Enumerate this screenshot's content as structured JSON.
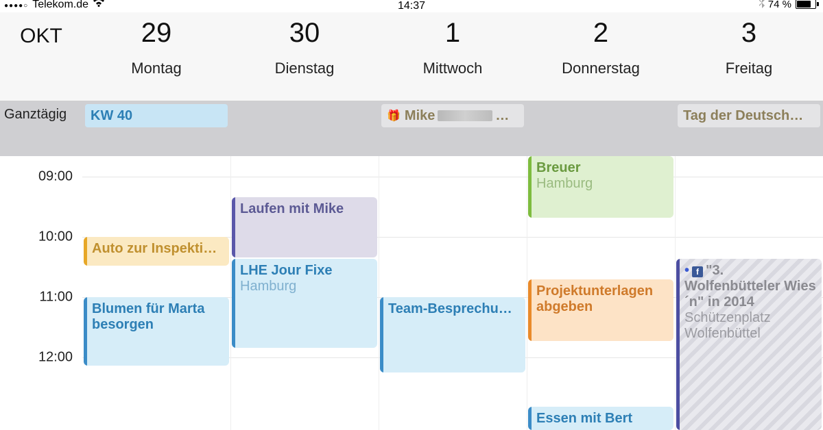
{
  "status": {
    "carrier": "Telekom.de",
    "time": "14:37",
    "battery_pct": "74 %"
  },
  "header": {
    "month": "OKT",
    "days": [
      {
        "num": "29",
        "name": "Montag"
      },
      {
        "num": "30",
        "name": "Dienstag"
      },
      {
        "num": "1",
        "name": "Mittwoch"
      },
      {
        "num": "2",
        "name": "Donnerstag"
      },
      {
        "num": "3",
        "name": "Freitag"
      }
    ]
  },
  "allday": {
    "label": "Ganztägig",
    "events": {
      "mon": {
        "title": "KW 40"
      },
      "wed": {
        "title": "Mike",
        "suffix": "…"
      },
      "fri": {
        "title": "Tag der Deutsch…"
      }
    }
  },
  "times": [
    "09:00",
    "10:00",
    "11:00",
    "12:00"
  ],
  "events": {
    "mon_insp": {
      "title": "Auto zur Inspekti…"
    },
    "mon_blumen": {
      "title": "Blumen für Marta besorgen"
    },
    "tue_laufen": {
      "title": "Laufen mit Mike"
    },
    "tue_lhe": {
      "title": "LHE Jour Fixe",
      "sub": "Hamburg"
    },
    "wed_team": {
      "title": "Team-Besprechu…"
    },
    "thu_breuer": {
      "title": "Breuer",
      "sub": "Hamburg"
    },
    "thu_proj": {
      "title": "Projektunterlagen abgeben"
    },
    "thu_essen": {
      "title": "Essen mit Bert"
    },
    "fri_wiesn": {
      "title": "\"3. Wolfenbütteler Wies´n\" in 2014",
      "sub": "Schützenplatz Wolfenbüttel"
    }
  }
}
